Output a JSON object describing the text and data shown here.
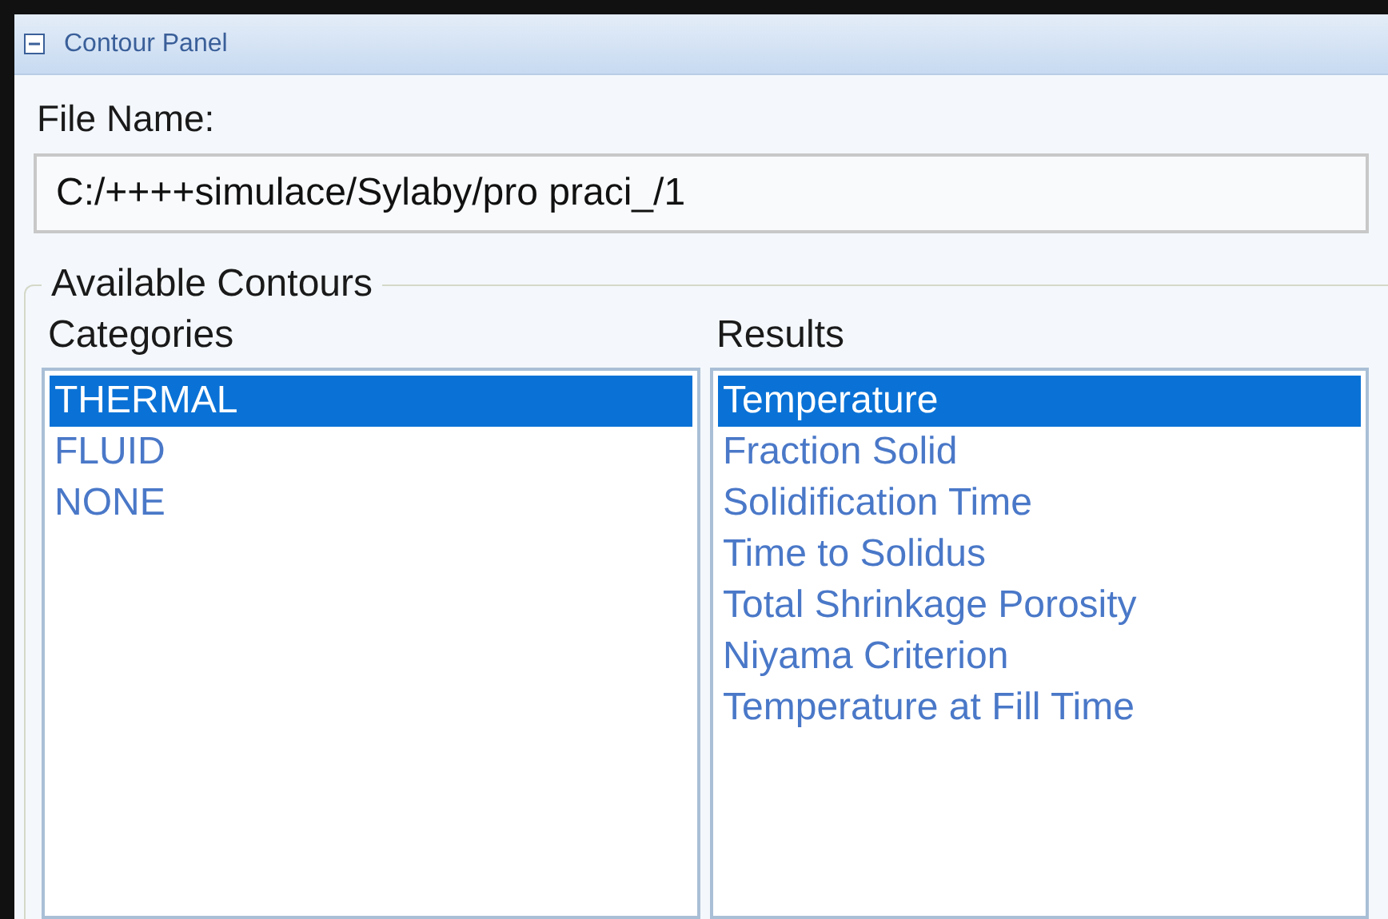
{
  "panel": {
    "title": "Contour Panel",
    "expanded": true
  },
  "file_name": {
    "label": "File Name:",
    "value": "C:/++++simulace/Sylaby/pro praci_/1"
  },
  "available_contours": {
    "legend": "Available Contours",
    "categories": {
      "label": "Categories",
      "items": [
        {
          "label": "THERMAL",
          "selected": true
        },
        {
          "label": "FLUID",
          "selected": false
        },
        {
          "label": "NONE",
          "selected": false
        }
      ]
    },
    "results": {
      "label": "Results",
      "items": [
        {
          "label": "Temperature",
          "selected": true
        },
        {
          "label": "Fraction Solid",
          "selected": false
        },
        {
          "label": "Solidification Time",
          "selected": false
        },
        {
          "label": "Time to Solidus",
          "selected": false
        },
        {
          "label": "Total Shrinkage Porosity",
          "selected": false
        },
        {
          "label": "Niyama Criterion",
          "selected": false
        },
        {
          "label": "Temperature at Fill Time",
          "selected": false
        }
      ]
    }
  }
}
